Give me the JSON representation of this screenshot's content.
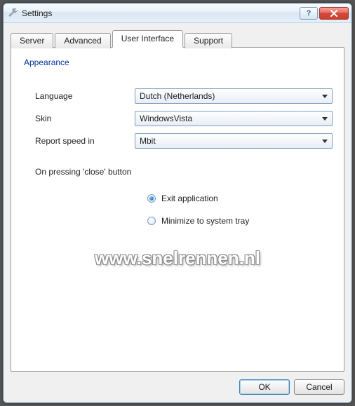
{
  "window": {
    "title": "Settings"
  },
  "tabs": {
    "server": "Server",
    "advanced": "Advanced",
    "user_interface": "User Interface",
    "support": "Support"
  },
  "group": {
    "appearance": "Appearance"
  },
  "labels": {
    "language": "Language",
    "skin": "Skin",
    "report_speed": "Report speed in",
    "on_close": "On pressing 'close' button"
  },
  "values": {
    "language": "Dutch (Netherlands)",
    "skin": "WindowsVista",
    "report_speed": "Mbit"
  },
  "radios": {
    "exit": "Exit application",
    "minimize": "Minimize to system tray",
    "selected": "exit"
  },
  "buttons": {
    "ok": "OK",
    "cancel": "Cancel"
  },
  "watermark": "www.snelrennen.nl"
}
